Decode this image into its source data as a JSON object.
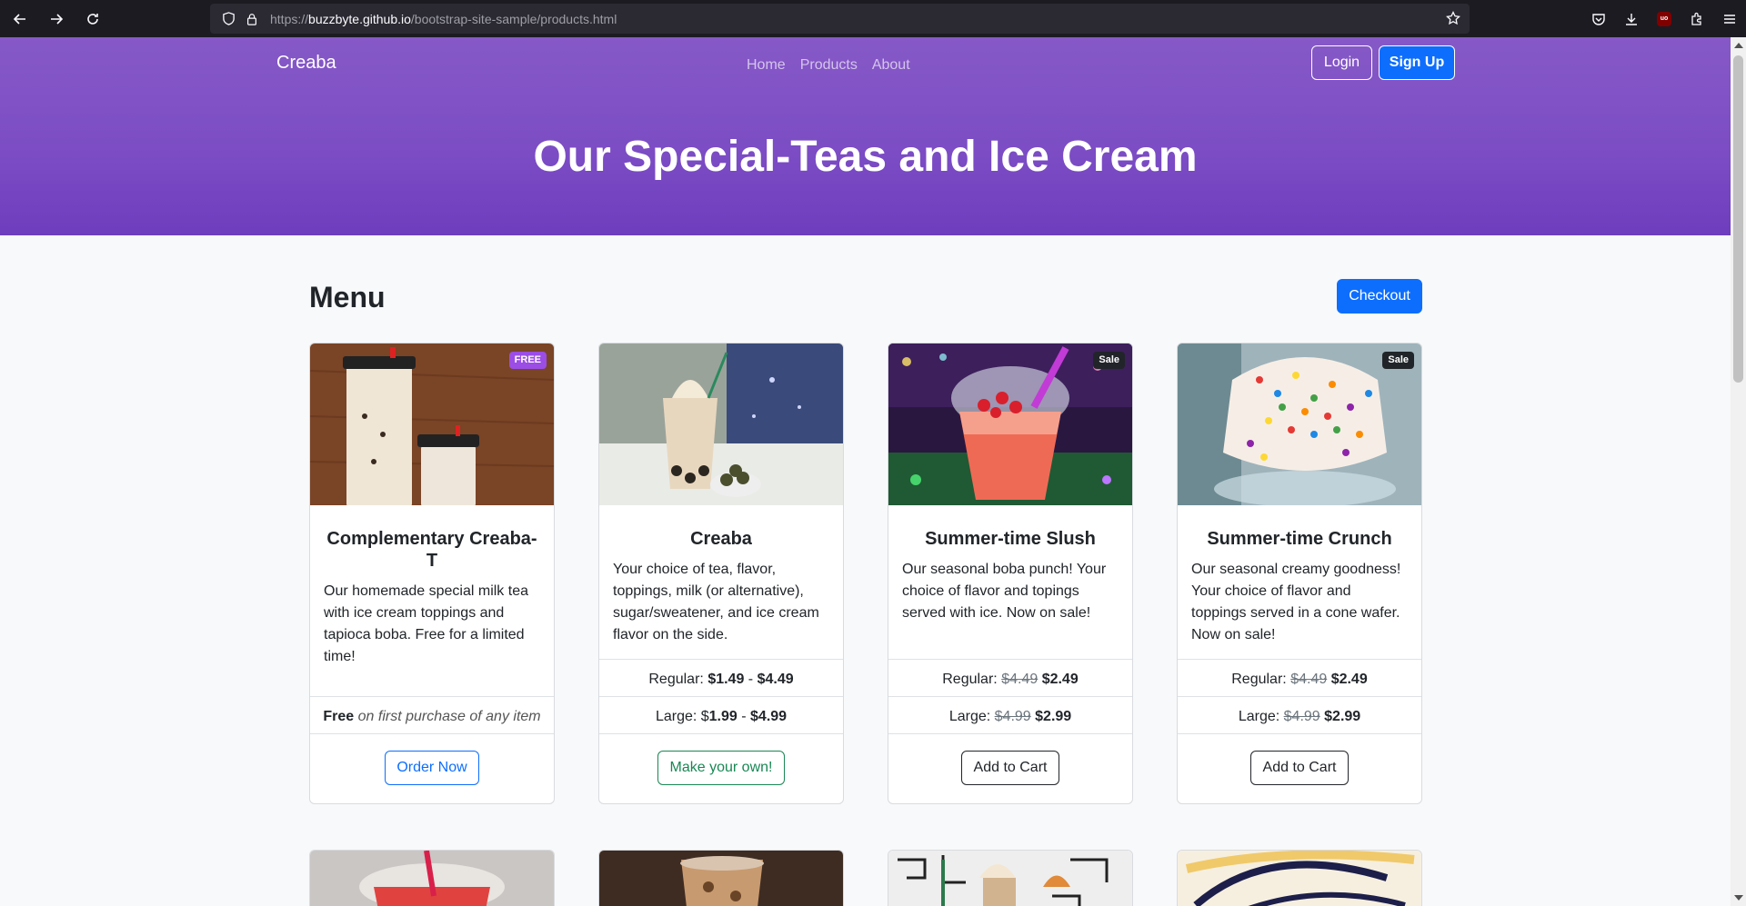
{
  "browser": {
    "url_prefix": "https://",
    "url_host": "buzzbyte.github.io",
    "url_path": "/bootstrap-site-sample/products.html",
    "extension_badge": "uo"
  },
  "navbar": {
    "brand": "Creaba",
    "links": [
      "Home",
      "Products",
      "About"
    ],
    "login_label": "Login",
    "signup_label": "Sign Up"
  },
  "hero": {
    "title": "Our Special-Teas and Ice Cream"
  },
  "menu": {
    "heading": "Menu",
    "checkout_label": "Checkout",
    "cards": [
      {
        "badge": "FREE",
        "title": "Complementary Creaba-T",
        "text": "Our homemade special milk tea with ice cream toppings and tapioca boba. Free for a limited time!",
        "price_lines": [],
        "free_bold": "Free",
        "free_italic": "on first purchase of any item",
        "button": "Order Now"
      },
      {
        "badge": "",
        "title": "Creaba",
        "text": "Your choice of tea, flavor, toppings, milk (or alternative), sugar/sweatener, and ice cream flavor on the side.",
        "regular_label": "Regular:",
        "regular_low": "$1.49",
        "regular_high": "$4.49",
        "large_label": "Large: $",
        "large_low": "1.99",
        "large_high": "$4.99",
        "button": "Make your own!"
      },
      {
        "badge": "Sale",
        "title": "Summer-time Slush",
        "text": "Our seasonal boba punch! Your choice of flavor and topings served with ice. Now on sale!",
        "regular_label": "Regular:",
        "regular_old": "$4.49",
        "regular_new": "$2.49",
        "large_label": "Large:",
        "large_old": "$4.99",
        "large_new": "$2.99",
        "button": "Add to Cart"
      },
      {
        "badge": "Sale",
        "title": "Summer-time Crunch",
        "text": "Our seasonal creamy goodness! Your choice of flavor and toppings served in a cone wafer. Now on sale!",
        "regular_label": "Regular:",
        "regular_old": "$4.49",
        "regular_new": "$2.49",
        "large_label": "Large:",
        "large_old": "$4.99",
        "large_new": "$2.99",
        "button": "Add to Cart"
      }
    ]
  },
  "colors": {
    "hero_purple": "#7b4cc4",
    "primary_blue": "#0d6efd",
    "success_green": "#198754",
    "free_badge": "#9b4de6",
    "sale_badge": "#212529"
  }
}
